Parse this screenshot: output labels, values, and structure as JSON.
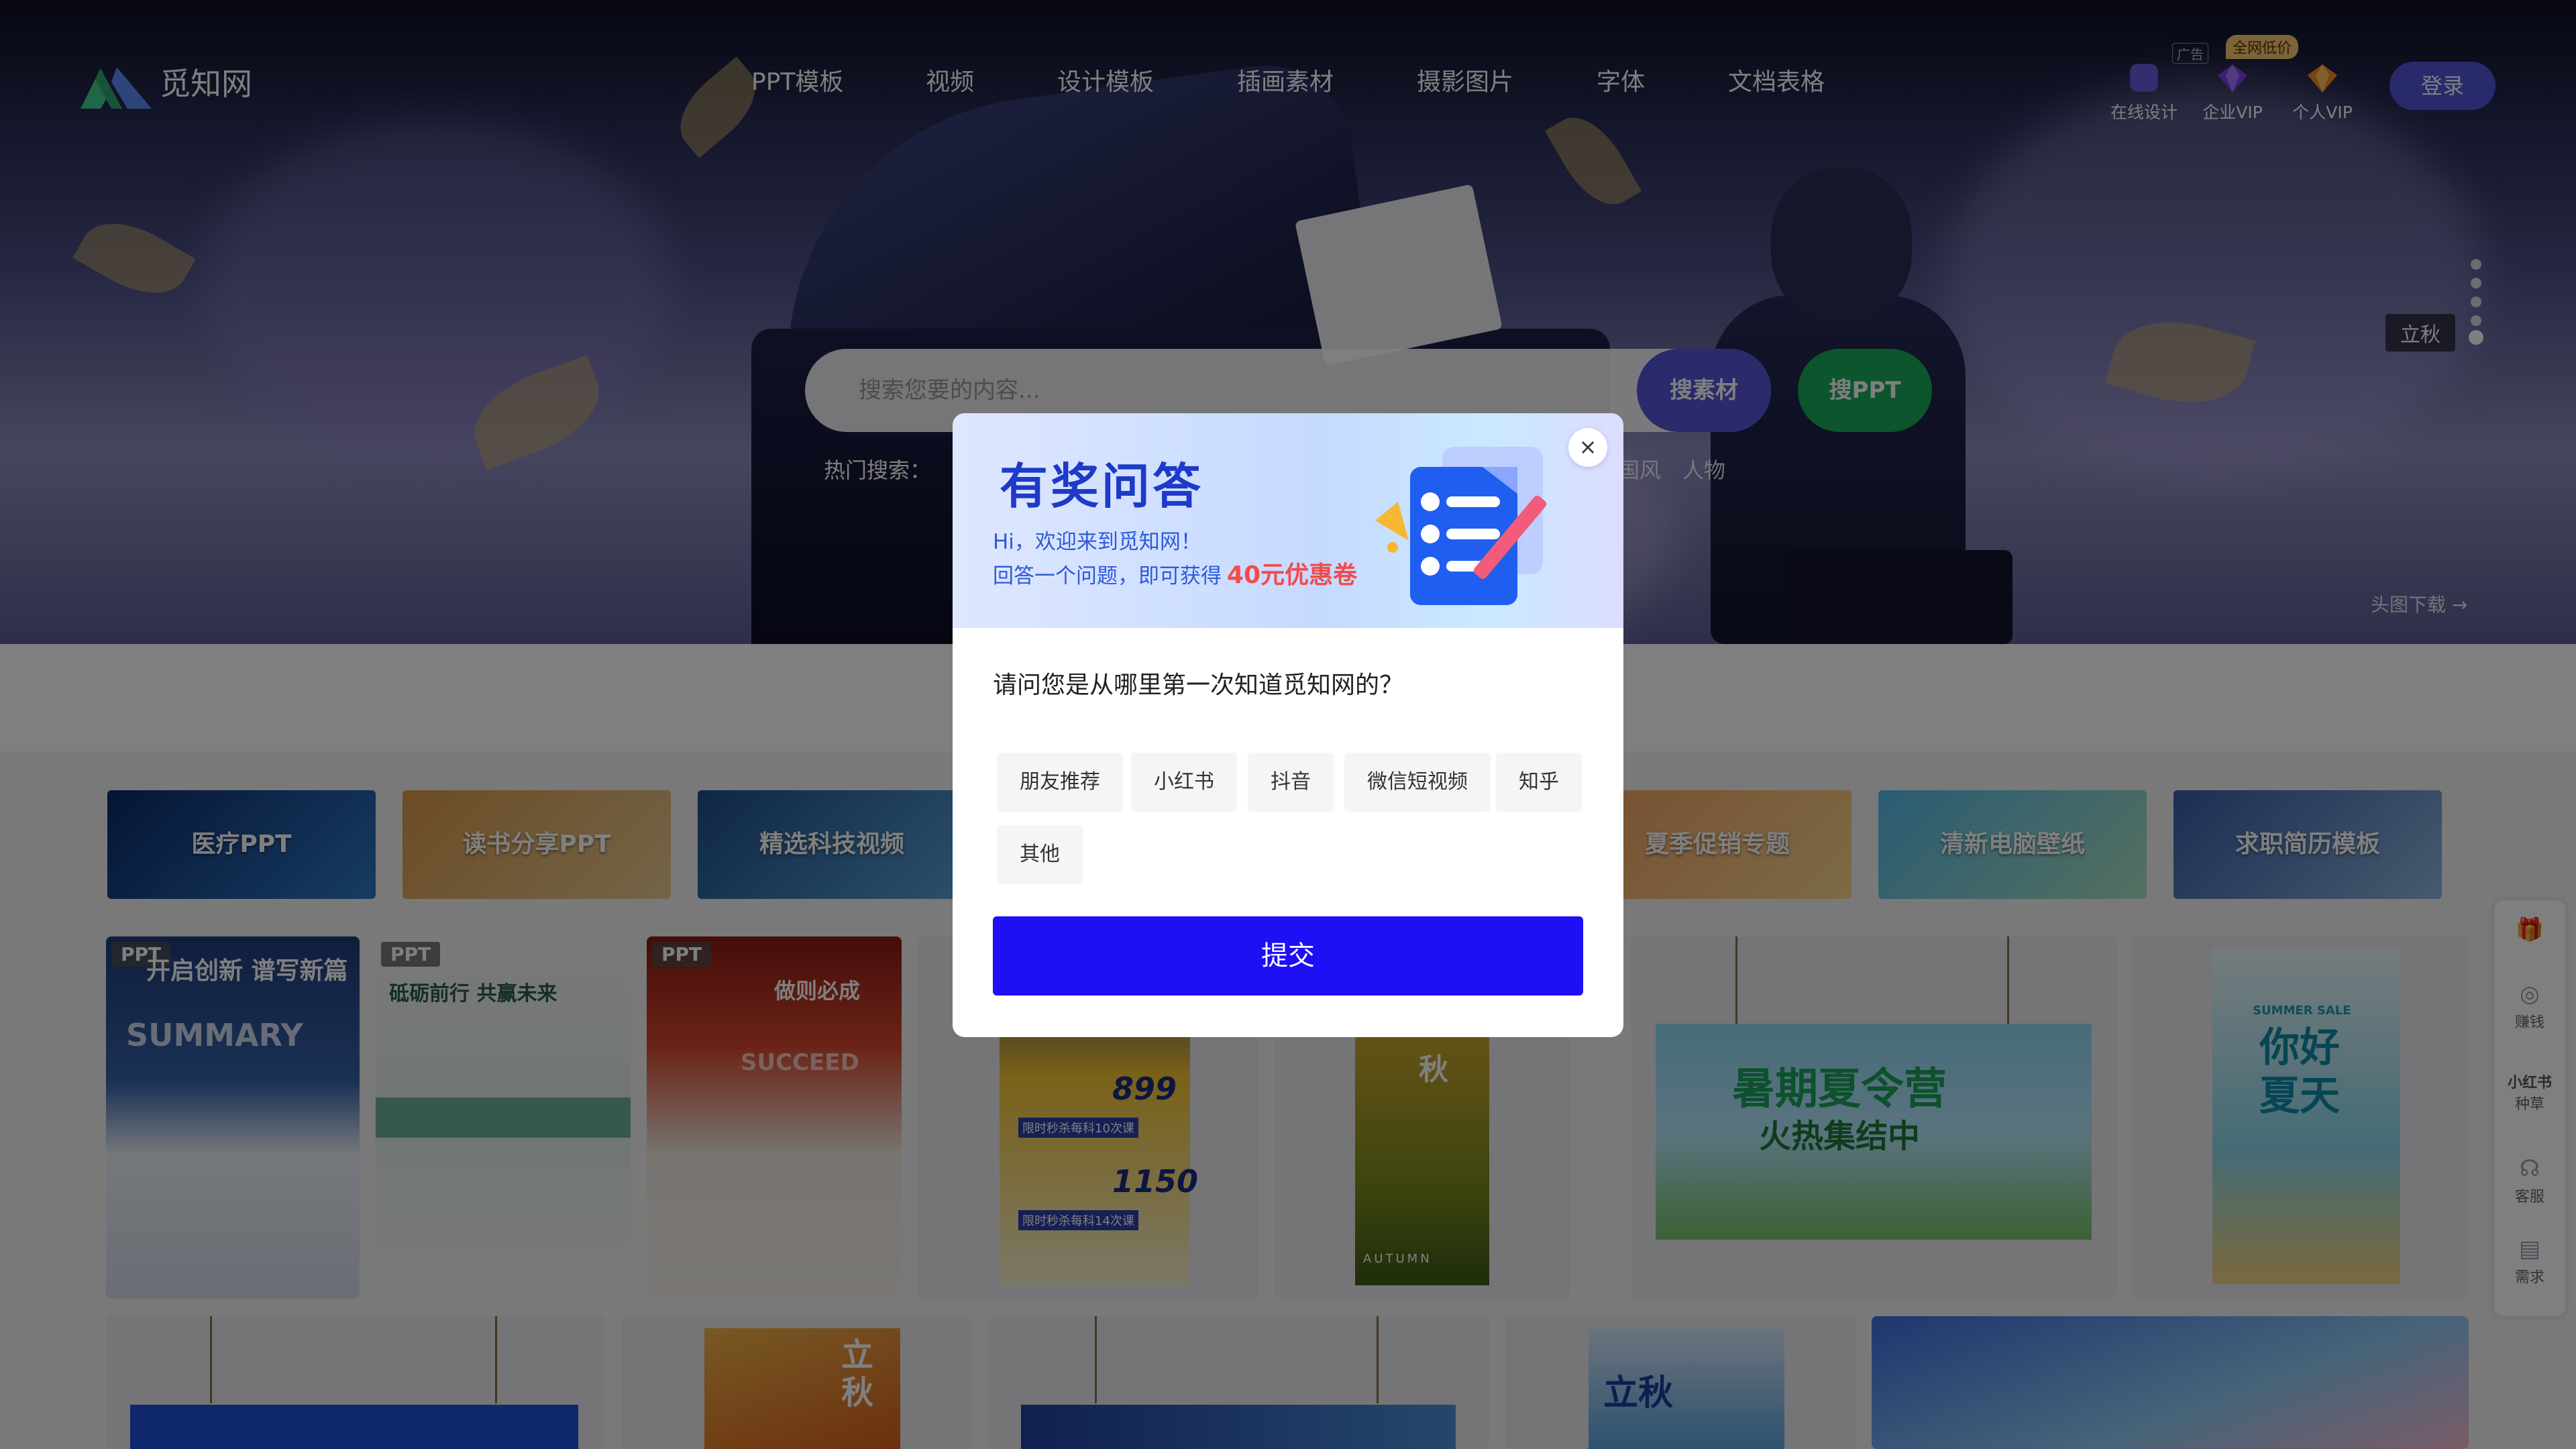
{
  "brand": {
    "name": "觅知网"
  },
  "nav": {
    "items": [
      "PPT模板",
      "视频",
      "设计模板",
      "插画素材",
      "摄影图片",
      "字体",
      "文档表格"
    ]
  },
  "header": {
    "ad_tag": "广告",
    "vip_badge": "全网低价",
    "tools": [
      {
        "label": "在线设计",
        "icon": "online-design-icon",
        "color": "#6a5ae0"
      },
      {
        "label": "企业VIP",
        "icon": "diamond-purple-icon",
        "color": "#7b3fe8"
      },
      {
        "label": "个人VIP",
        "icon": "diamond-orange-icon",
        "color": "#f08a1c"
      }
    ],
    "login_label": "登录"
  },
  "search": {
    "placeholder": "搜索您要的内容...",
    "btn_material": "搜素材",
    "btn_ppt": "搜PPT",
    "hot_label": "热门搜索：",
    "hot_tags_visible": [
      "国风",
      "人物"
    ]
  },
  "hero": {
    "season_tag": "立秋",
    "head_download": "头图下载 →"
  },
  "categories": [
    "医疗PPT",
    "读书分享PPT",
    "精选科技视频",
    "夏季促销专题",
    "清新电脑壁纸",
    "求职简历模板"
  ],
  "cards": {
    "ppt_badge": "PPT",
    "card1_title": "开启创新 谱写新篇",
    "card1_sub": "SUMMARY",
    "card2_title": "砥砺前行 共赢未来",
    "card3_title": "做则必成",
    "card3_sub": "SUCCEED",
    "price1": "899",
    "price2": "1150",
    "price_line1": "限时秒杀每科10次课",
    "price_line2": "限时秒杀每科14次课",
    "autumn_char": "秋",
    "autumn_en": "AUTUMN",
    "summer_camp_title": "暑期夏令营",
    "summer_camp_sub": "火热集结中",
    "summer_sale_en": "SUMMER SALE",
    "summer_sale_title": "你好\n夏天",
    "lqiu": "立秋",
    "lqiu_char": "立\n秋"
  },
  "siderail": {
    "items": [
      {
        "label": "",
        "icon": "gift-icon"
      },
      {
        "label": "赚钱",
        "icon": "money-icon"
      },
      {
        "label": "种草",
        "icon": "xiaohongshu-icon",
        "title": "小红书"
      },
      {
        "label": "客服",
        "icon": "headset-icon"
      },
      {
        "label": "需求",
        "icon": "inbox-icon"
      }
    ]
  },
  "modal": {
    "title": "有奖问答",
    "welcome": "Hi，欢迎来到觅知网！",
    "line2_prefix": "回答一个问题，即可获得",
    "coupon": "40元优惠卷",
    "question": "请问您是从哪里第一次知道觅知网的？",
    "options": [
      "朋友推荐",
      "小红书",
      "抖音",
      "微信短视频",
      "知乎",
      "其他"
    ],
    "submit": "提交",
    "close": "×"
  },
  "colors": {
    "accent": "#1f0ff5",
    "login": "#5154d6",
    "search_ppt": "#1aaa5a",
    "coupon": "#f44a4a",
    "modal_title": "#1d3ac8"
  }
}
